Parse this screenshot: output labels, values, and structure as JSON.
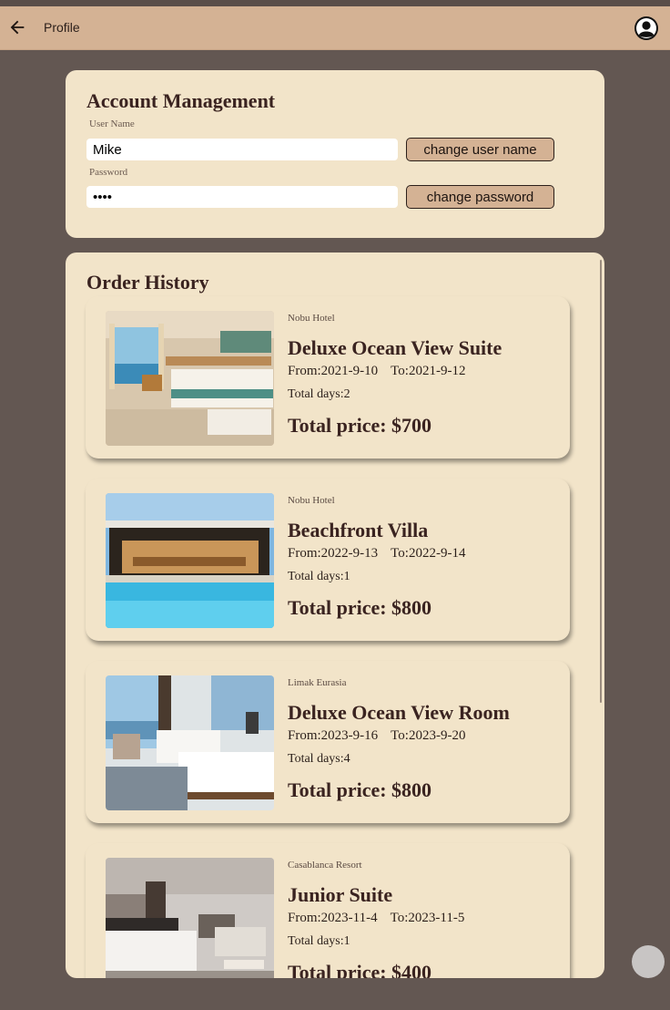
{
  "appbar": {
    "title": "Profile"
  },
  "account": {
    "title": "Account Management",
    "username_label": "User Name",
    "username_value": "Mike",
    "change_username_label": "change user name",
    "password_label": "Password",
    "password_value": "abcd",
    "change_password_label": "change password"
  },
  "history": {
    "title": "Order History",
    "orders": [
      {
        "hotel": "Nobu Hotel",
        "room": "Deluxe Ocean View Suite",
        "from": "From:2021-9-10",
        "to": "To:2021-9-12",
        "days": "Total days:2",
        "price": "Total price: $700"
      },
      {
        "hotel": "Nobu Hotel",
        "room": "Beachfront Villa",
        "from": "From:2022-9-13",
        "to": "To:2022-9-14",
        "days": "Total days:1",
        "price": "Total price: $800"
      },
      {
        "hotel": "Limak Eurasia",
        "room": "Deluxe Ocean View Room",
        "from": "From:2023-9-16",
        "to": "To:2023-9-20",
        "days": "Total days:4",
        "price": "Total price: $800"
      },
      {
        "hotel": "Casablanca Resort",
        "room": "Junior Suite",
        "from": "From:2023-11-4",
        "to": "To:2023-11-5",
        "days": "Total days:1",
        "price": "Total price: $400"
      }
    ]
  },
  "colors": {
    "background": "#635752",
    "appbar": "#d4b294",
    "card": "#f2e4c9",
    "button": "#d4b294",
    "heading": "#3a2320"
  },
  "icons": {
    "back": "arrow-left-icon",
    "avatar": "user-avatar-icon"
  }
}
